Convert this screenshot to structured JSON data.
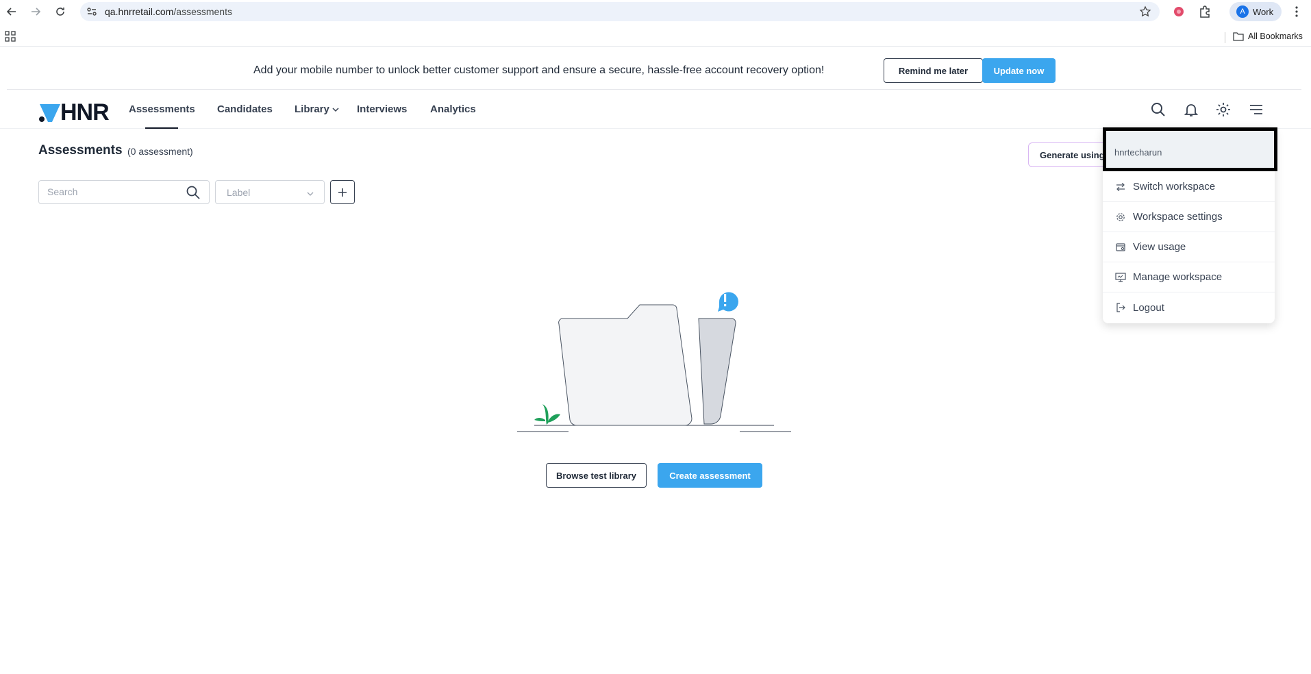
{
  "browser": {
    "url_host": "qa.hnrretail.com",
    "url_path": "/assessments",
    "profile_initial": "A",
    "profile_label": "Work",
    "all_bookmarks": "All Bookmarks"
  },
  "banner": {
    "message": "Add your mobile number to unlock better customer support and ensure a secure, hassle-free account recovery option!",
    "remind_label": "Remind me later",
    "update_label": "Update now"
  },
  "header": {
    "logo_text": "HNR",
    "nav": {
      "assessments": "Assessments",
      "candidates": "Candidates",
      "library": "Library",
      "interviews": "Interviews",
      "analytics": "Analytics"
    }
  },
  "page": {
    "title": "Assessments",
    "count": "(0 assessment)",
    "generate_label": "Generate using AI",
    "search_placeholder": "Search",
    "label_placeholder": "Label"
  },
  "empty_state": {
    "browse_label": "Browse test library",
    "create_label": "Create assessment"
  },
  "user_menu": {
    "username": "hnrtecharun",
    "items": [
      {
        "label": "Switch workspace",
        "icon": "switch-icon"
      },
      {
        "label": "Workspace settings",
        "icon": "gear-icon"
      },
      {
        "label": "View usage",
        "icon": "usage-icon"
      },
      {
        "label": "Manage workspace",
        "icon": "monitor-icon"
      },
      {
        "label": "Logout",
        "icon": "logout-icon"
      }
    ]
  },
  "colors": {
    "accent": "#3ba6ee",
    "logo_blue": "#3ba6ee",
    "highlight_border": "#000000"
  }
}
